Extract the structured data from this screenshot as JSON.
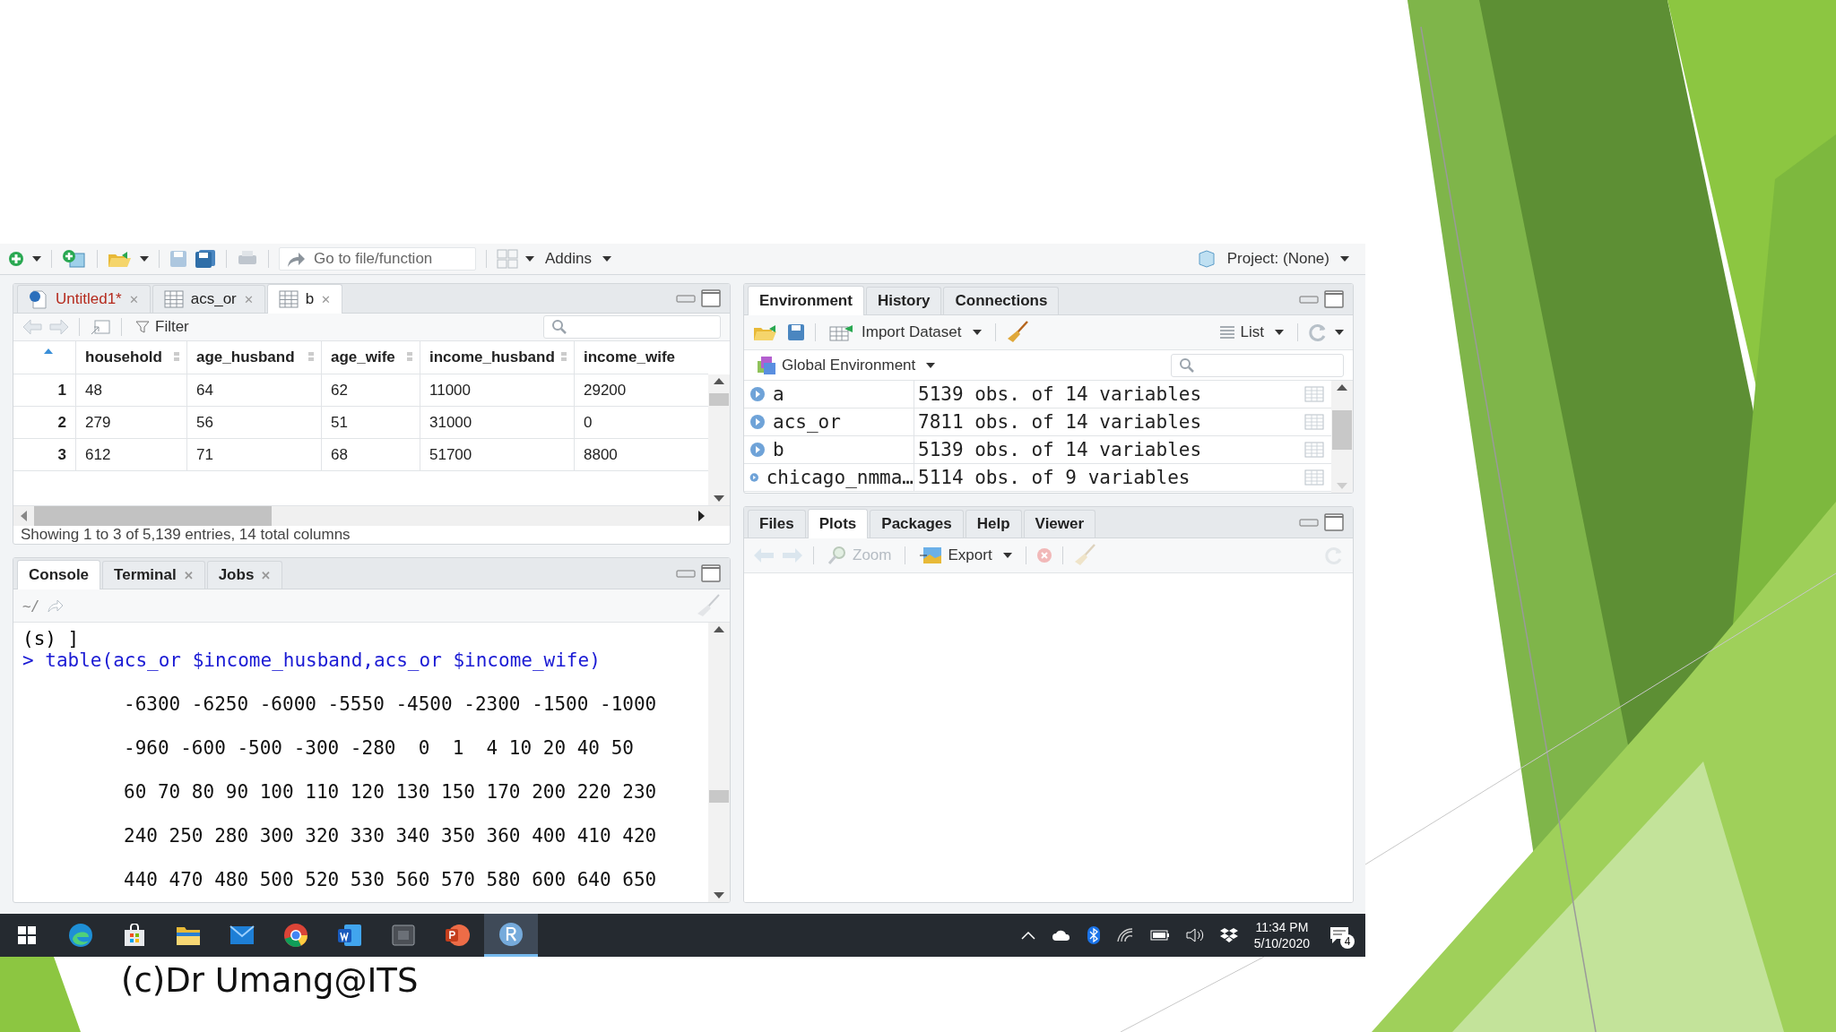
{
  "toolbar": {
    "goto_placeholder": "Go to file/function",
    "addins": "Addins",
    "project": "Project: (None)"
  },
  "source": {
    "tabs": [
      {
        "label": "Untitled1*",
        "kind": "script",
        "unsaved": true,
        "selected": false,
        "close": "✕"
      },
      {
        "label": "acs_or",
        "kind": "data",
        "unsaved": false,
        "selected": false,
        "close": "✕"
      },
      {
        "label": "b",
        "kind": "data",
        "unsaved": false,
        "selected": true,
        "close": "✕"
      }
    ],
    "filter": "Filter",
    "table": {
      "columns": [
        "household",
        "age_husband",
        "age_wife",
        "income_husband",
        "income_wife"
      ],
      "rows": [
        {
          "number": "1",
          "cells": [
            "48",
            "64",
            "62",
            "11000",
            "29200"
          ]
        },
        {
          "number": "2",
          "cells": [
            "279",
            "56",
            "51",
            "31000",
            "0"
          ]
        },
        {
          "number": "3",
          "cells": [
            "612",
            "71",
            "68",
            "51700",
            "8800"
          ]
        }
      ]
    },
    "status": "Showing 1 to 3 of 5,139 entries, 14 total columns"
  },
  "console": {
    "tabs": [
      {
        "label": "Console",
        "selected": true
      },
      {
        "label": "Terminal",
        "close": "✕",
        "selected": false
      },
      {
        "label": "Jobs",
        "close": "✕",
        "selected": false
      }
    ],
    "path": "~/",
    "lines": [
      {
        "kind": "output",
        "text": "(s) ]"
      },
      {
        "kind": "command",
        "text": "> table(acs_or $income_husband,acs_or $income_wife)"
      },
      {
        "kind": "table",
        "text": "-6300 -6250 -6000 -5550 -4500 -2300 -1500 -1000"
      },
      {
        "kind": "table",
        "text": "-960 -600 -500 -300 -280  0  1  4 10 20 40 50"
      },
      {
        "kind": "table",
        "text": "60 70 80 90 100 110 120 130 150 170 200 220 230"
      },
      {
        "kind": "table",
        "text": "240 250 280 300 320 330 340 350 360 400 410 420"
      },
      {
        "kind": "table",
        "text": "440 470 480 500 520 530 560 570 580 600 640 650"
      }
    ]
  },
  "environment": {
    "tabs": [
      {
        "label": "Environment",
        "selected": true
      },
      {
        "label": "History",
        "selected": false
      },
      {
        "label": "Connections",
        "selected": false
      }
    ],
    "import": "Import Dataset",
    "view": "List",
    "scope": "Global Environment",
    "rows": [
      {
        "name": "a",
        "value": "5139 obs. of 14 variables"
      },
      {
        "name": "acs_or",
        "value": "7811 obs. of 14 variables"
      },
      {
        "name": "b",
        "value": "5139 obs. of 14 variables"
      },
      {
        "name": "chicago_nmma…",
        "value": "5114 obs. of 9 variables"
      }
    ]
  },
  "plots": {
    "tabs": [
      {
        "label": "Files",
        "selected": false
      },
      {
        "label": "Plots",
        "selected": true
      },
      {
        "label": "Packages",
        "selected": false
      },
      {
        "label": "Help",
        "selected": false
      },
      {
        "label": "Viewer",
        "selected": false
      }
    ],
    "zoom": "Zoom",
    "export": "Export"
  },
  "taskbar": {
    "apps": [
      {
        "kind": "start",
        "active": false
      },
      {
        "kind": "edge",
        "active": false
      },
      {
        "kind": "store",
        "active": false
      },
      {
        "kind": "explorer",
        "active": false
      },
      {
        "kind": "mail",
        "active": false
      },
      {
        "kind": "chrome",
        "active": false
      },
      {
        "kind": "word",
        "active": false
      },
      {
        "kind": "window",
        "active": false
      },
      {
        "kind": "powerpoint",
        "active": false
      },
      {
        "kind": "r",
        "active": true
      }
    ],
    "time": "11:34 PM",
    "date": "5/10/2020",
    "notifications": "4"
  },
  "footer": "(c)Dr Umang@ITS"
}
